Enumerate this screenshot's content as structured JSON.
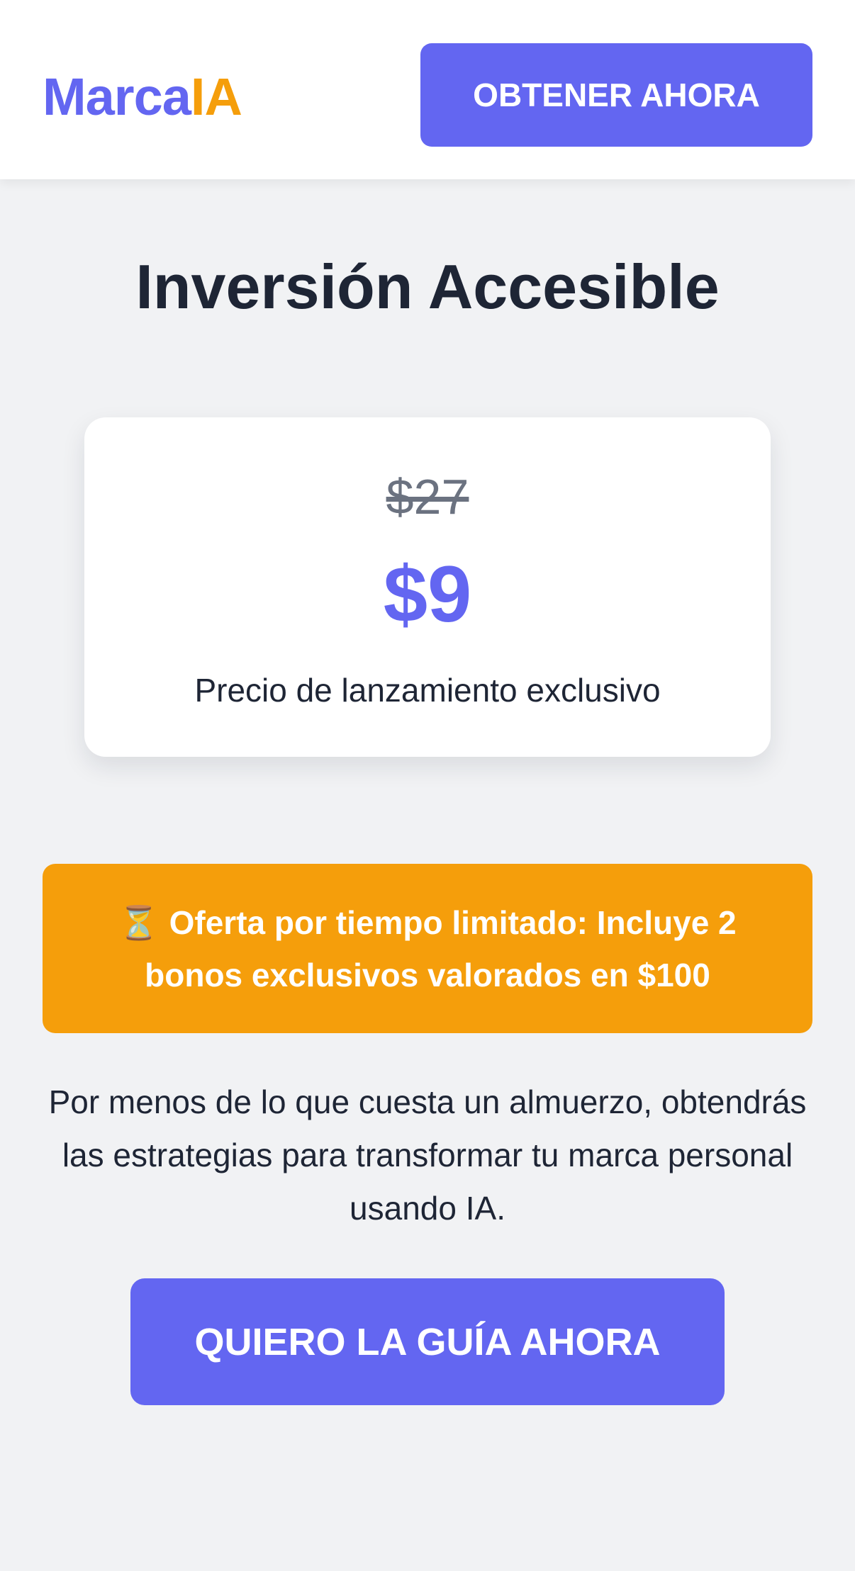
{
  "header": {
    "logo_part1": "Marca",
    "logo_part2": "IA",
    "cta_label": "OBTENER AHORA"
  },
  "pricing": {
    "title": "Inversión Accesible",
    "old_price": "$27",
    "new_price": "$9",
    "note": "Precio de lanzamiento exclusivo"
  },
  "offer": {
    "icon": "hourglass-icon",
    "icon_glyph": "⏳",
    "text": "Oferta por tiempo limitado: Incluye 2 bonos exclusivos valorados en $100"
  },
  "description": "Por menos de lo que cuesta un almuerzo, obtendrás las estrategias para transformar tu marca personal usando IA.",
  "main_cta": {
    "label": "QUIERO LA GUÍA AHORA"
  },
  "colors": {
    "primary": "#6366f1",
    "accent": "#f59e0b",
    "background": "#f1f2f4",
    "text": "#1e2535",
    "muted": "#6b7280"
  }
}
